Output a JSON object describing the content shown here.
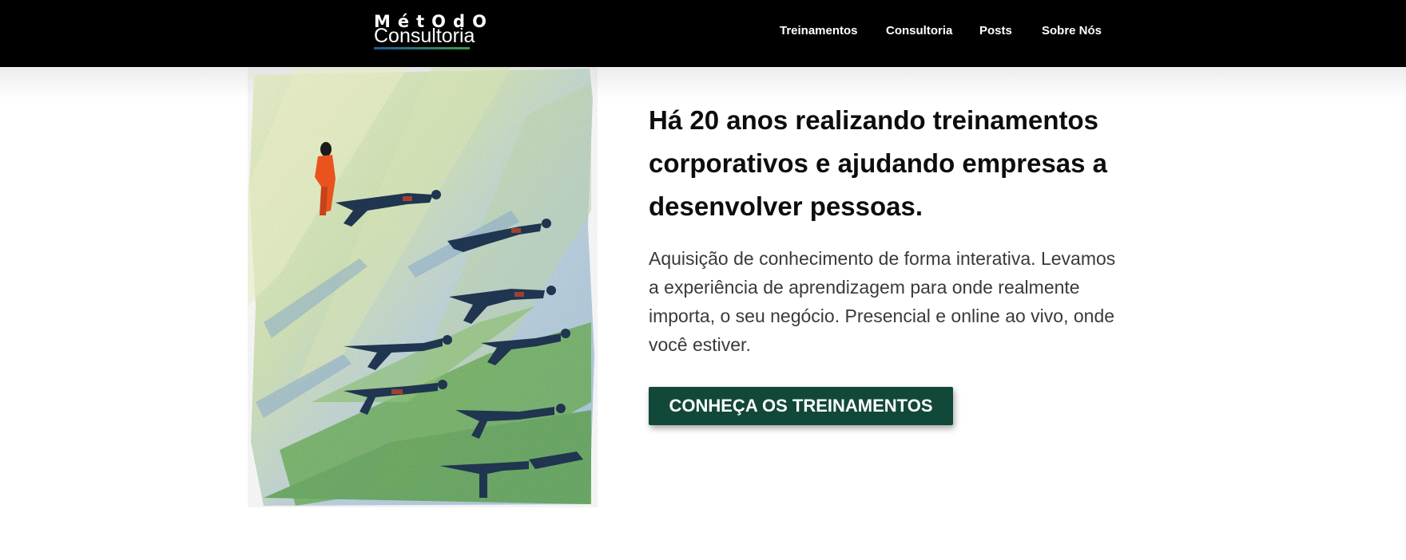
{
  "header": {
    "logo": {
      "line1": "MétOdO",
      "line2": "Consultoria",
      "name": "logo"
    },
    "nav": [
      {
        "label": "Treinamentos"
      },
      {
        "label": "Consultoria"
      },
      {
        "label": "Posts"
      },
      {
        "label": "Sobre Nós"
      }
    ]
  },
  "hero": {
    "image_description_icon": "painting-illustration",
    "headline": "Há 20 anos realizando treinamentos corporativos e ajudando empresas a desenvolver pessoas.",
    "description": "Aquisição de conhecimento de forma interativa. Levamos a experiência de aprendizagem para onde realmente importa, o seu negócio. Presencial e online ao vivo, onde você estiver.",
    "cta_label": "CONHEÇA OS TREINAMENTOS"
  },
  "colors": {
    "header_bg": "#000000",
    "cta_bg": "#12483a",
    "text_dark": "#0d0d0d",
    "text_body": "#3a3a3a"
  }
}
